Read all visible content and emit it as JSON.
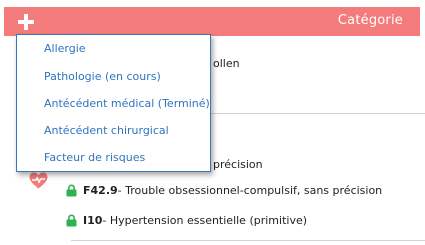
{
  "header": {
    "title": "Catégorie",
    "add_icon": "plus-icon",
    "background": "#f47b7b"
  },
  "background_text": {
    "row1_fragment": "ollen",
    "row3_fragment": "précision"
  },
  "rows": [
    {
      "code": "F42.9",
      "description": " - Trouble obsessionnel-compulsif, sans précision",
      "icon": "lock-icon"
    },
    {
      "code": "I10",
      "description": " - Hypertension essentielle (primitive)",
      "icon": "lock-icon"
    }
  ],
  "dropdown": {
    "items": [
      "Allergie",
      "Pathologie (en cours)",
      "Antécédent médical (Terminé)",
      "Antécédent chirurgical",
      "Facteur de risques"
    ],
    "text_color": "#2f74c0",
    "border_color": "#3a76b6"
  },
  "colors": {
    "lock": "#2db24f",
    "heart": "#f47b7b"
  }
}
